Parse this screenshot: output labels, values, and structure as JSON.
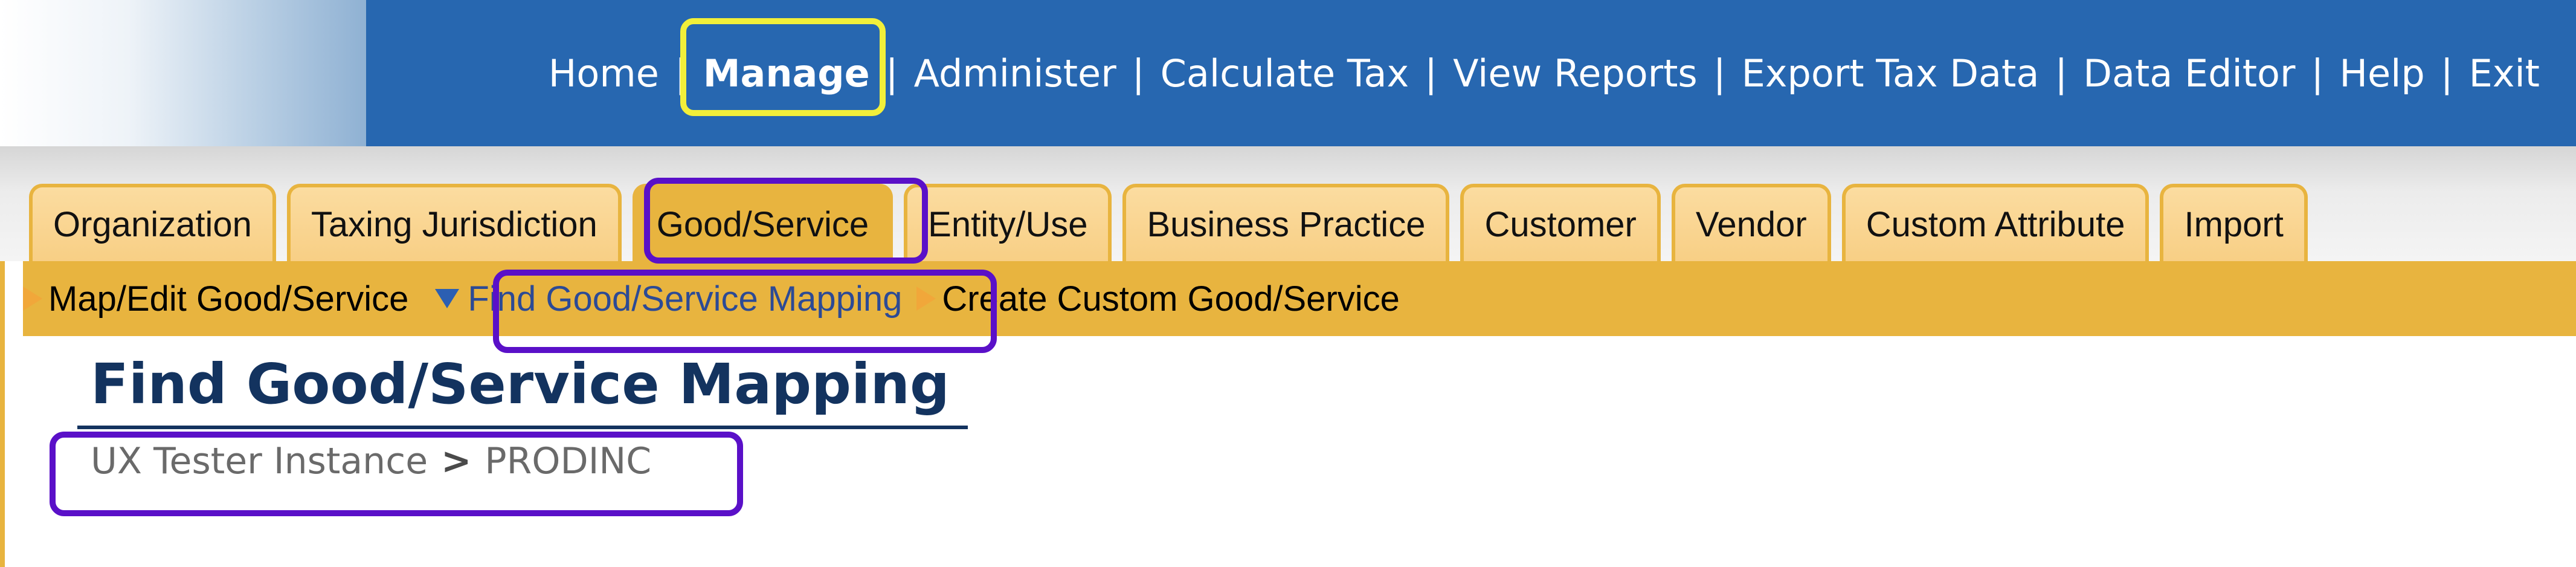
{
  "topnav": {
    "items": [
      {
        "label": "Home",
        "active": false
      },
      {
        "label": "Manage",
        "active": true
      },
      {
        "label": "Administer",
        "active": false
      },
      {
        "label": "Calculate Tax",
        "active": false
      },
      {
        "label": "View Reports",
        "active": false
      },
      {
        "label": "Export Tax Data",
        "active": false
      },
      {
        "label": "Data Editor",
        "active": false
      },
      {
        "label": "Help",
        "active": false
      },
      {
        "label": "Exit",
        "active": false
      }
    ],
    "separator": "|"
  },
  "tabs": [
    {
      "label": "Organization",
      "active": false
    },
    {
      "label": "Taxing Jurisdiction",
      "active": false
    },
    {
      "label": "Good/Service",
      "active": true
    },
    {
      "label": "Entity/Use",
      "active": false
    },
    {
      "label": "Business Practice",
      "active": false
    },
    {
      "label": "Customer",
      "active": false
    },
    {
      "label": "Vendor",
      "active": false
    },
    {
      "label": "Custom Attribute",
      "active": false
    },
    {
      "label": "Import",
      "active": false
    }
  ],
  "subnav": {
    "items": [
      {
        "label": "Map/Edit Good/Service",
        "active": false,
        "icon": "triangle-right-icon"
      },
      {
        "label": "Find Good/Service Mapping",
        "active": true,
        "icon": "triangle-down-icon"
      },
      {
        "label": "Create Custom Good/Service",
        "active": false,
        "icon": "triangle-right-icon"
      }
    ]
  },
  "page": {
    "title": "Find Good/Service Mapping",
    "breadcrumb": {
      "parent": "UX Tester Instance",
      "separator": ">",
      "current": "PRODINC"
    }
  },
  "colors": {
    "topbar": "#2767b0",
    "tab": "#f8cf85",
    "tab_active": "#e8b43f",
    "subbar": "#e8b43f",
    "title": "#13335f",
    "highlight_yellow": "#f2ef3a",
    "highlight_purple": "#5a10c8"
  }
}
